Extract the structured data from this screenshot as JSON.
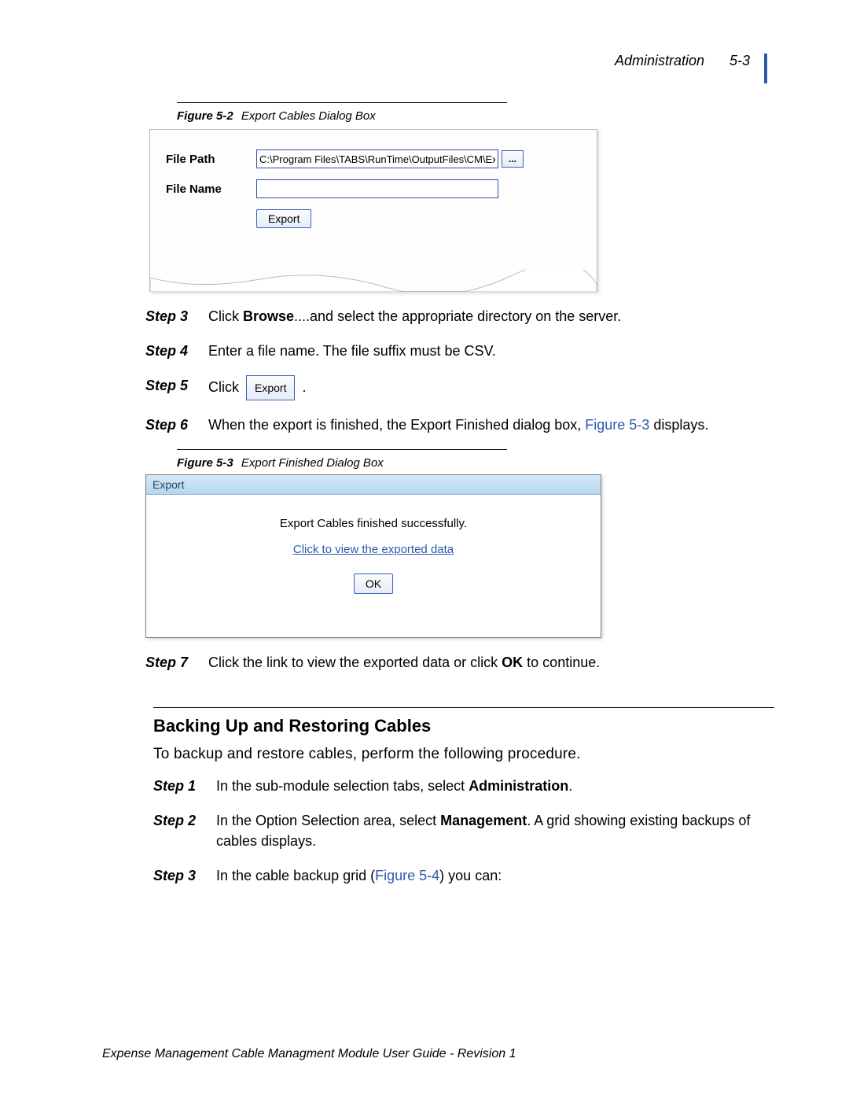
{
  "header": {
    "section": "Administration",
    "pagenum": "5-3"
  },
  "fig52": {
    "caption_num": "Figure 5-2",
    "caption_title": "Export Cables Dialog Box",
    "filepath_label": "File Path",
    "filepath_value": "C:\\Program Files\\TABS\\RunTime\\OutputFiles\\CM\\Ex",
    "filename_label": "File Name",
    "filename_value": "",
    "browse_label": "...",
    "export_label": "Export"
  },
  "steps_a": {
    "s3_label": "Step 3",
    "s3_prefix": "Click ",
    "s3_bold": "Browse",
    "s3_suffix": "....and select the appropriate directory on the server.",
    "s4_label": "Step 4",
    "s4_text": "Enter a file name. The file suffix must be CSV.",
    "s5_label": "Step 5",
    "s5_prefix": "Click ",
    "s5_btn": "Export",
    "s5_suffix": " .",
    "s6_label": "Step 6",
    "s6_prefix": "When the export is finished, the Export Finished dialog box, ",
    "s6_link": "Figure 5-3",
    "s6_suffix": " displays."
  },
  "fig53": {
    "caption_num": "Figure 5-3",
    "caption_title": "Export Finished Dialog Box",
    "titlebar": "Export",
    "message": "Export Cables finished successfully.",
    "link": "Click to view the exported data",
    "ok": "OK"
  },
  "steps_b": {
    "s7_label": "Step 7",
    "s7_prefix": "Click the link to view the exported data or click ",
    "s7_bold": "OK",
    "s7_suffix": " to continue."
  },
  "section2": {
    "heading": "Backing Up and Restoring Cables",
    "intro": "To backup and restore cables, perform the following procedure.",
    "s1_label": "Step 1",
    "s1_prefix": "In the sub-module selection tabs, select ",
    "s1_bold": "Administration",
    "s1_suffix": ".",
    "s2_label": "Step 2",
    "s2_prefix": "In the Option Selection area, select ",
    "s2_bold": "Management",
    "s2_suffix": ". A grid showing existing backups of cables displays.",
    "s3_label": "Step 3",
    "s3_prefix": "In the cable backup grid (",
    "s3_link": "Figure 5-4",
    "s3_suffix": ") you can:"
  },
  "footer": "Expense Management Cable Managment Module User Guide - Revision 1"
}
